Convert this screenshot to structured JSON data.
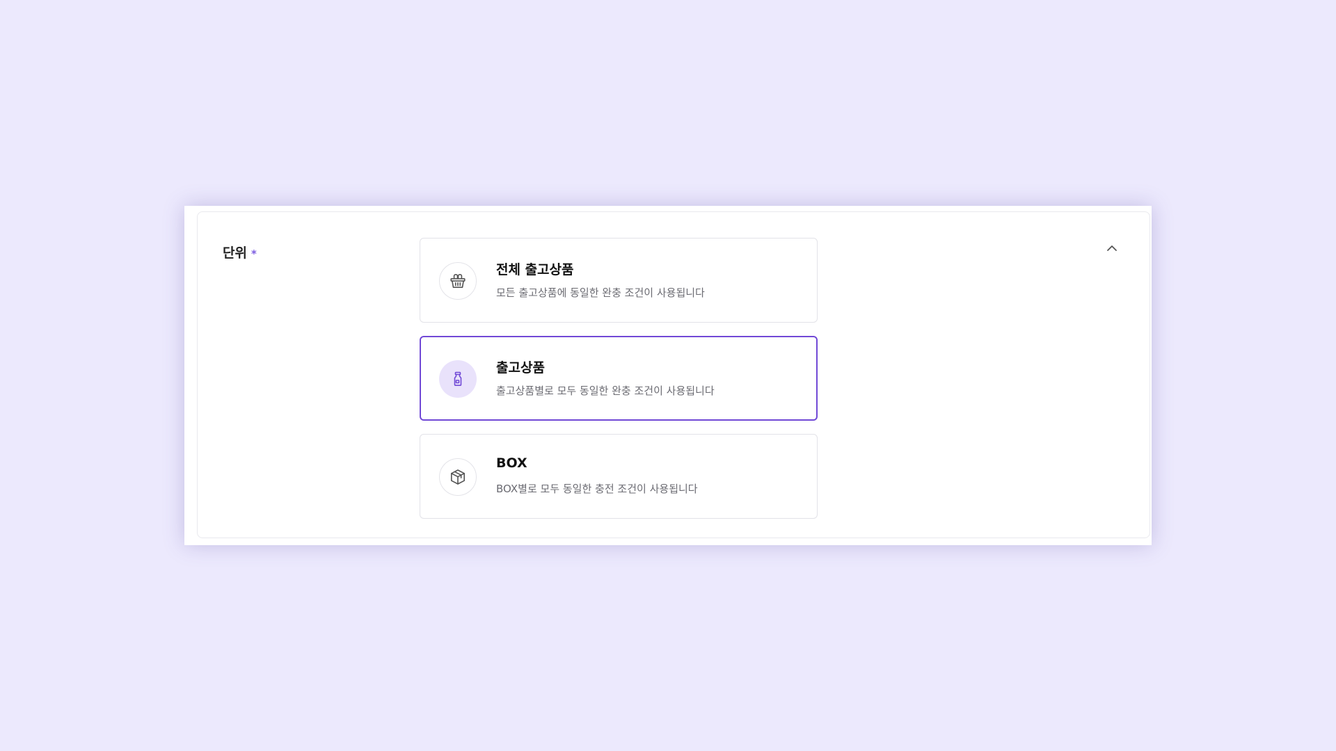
{
  "field": {
    "label": "단위",
    "required_mark": "*"
  },
  "collapse": {
    "icon": "chevron-up-icon"
  },
  "options": [
    {
      "title": "전체 출고상품",
      "description": "모든 출고상품에 동일한 완충 조건이 사용됩니다",
      "icon": "basket-icon",
      "selected": false
    },
    {
      "title": "출고상품",
      "description": "출고상품별로 모두 동일한 완충 조건이 사용됩니다",
      "icon": "bottle-icon",
      "selected": true
    },
    {
      "title": "BOX",
      "description": "BOX별로 모두 동일한 충전 조건이 사용됩니다",
      "icon": "box-icon",
      "selected": false
    }
  ],
  "colors": {
    "page_background": "#ece9fd",
    "accent": "#7149d6",
    "selected_icon_background": "#e9e2fb",
    "required_mark": "#7b5be0"
  }
}
